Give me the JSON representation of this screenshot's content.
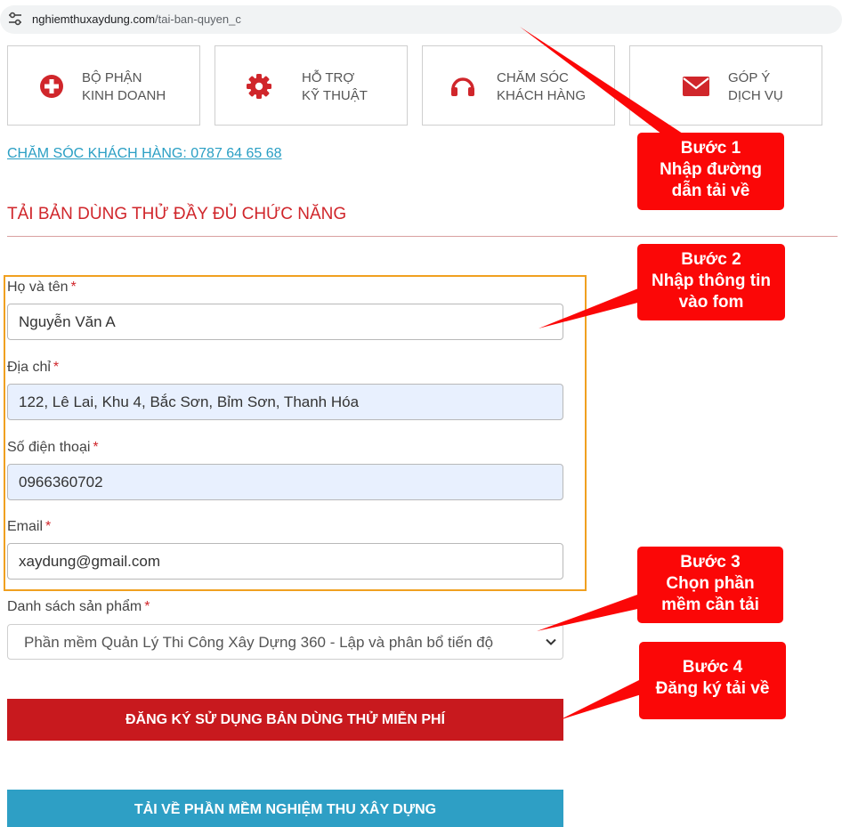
{
  "browser": {
    "url_host": "nghiemthuxaydung.com",
    "url_path": "/tai-ban-quyen_c",
    "site_info_icon": "tune-icon"
  },
  "support": [
    {
      "line1": "BỘ PHẬN",
      "line2": "KINH DOANH",
      "icon": "plus-circle-icon"
    },
    {
      "line1": "HỖ TRỢ",
      "line2": "KỸ THUẬT",
      "icon": "gear-icon"
    },
    {
      "line1": "CHĂM SÓC",
      "line2": "KHÁCH HÀNG",
      "icon": "headphones-icon"
    },
    {
      "line1": "GÓP Ý",
      "line2": "DỊCH VỤ",
      "icon": "envelope-icon"
    }
  ],
  "hotline": "CHĂM SÓC KHÁCH HÀNG: 0787 64 65 68",
  "section_title": "TẢI BẢN DÙNG THỬ ĐẦY ĐỦ CHỨC NĂNG",
  "form": {
    "required_mark": "*",
    "name": {
      "label": "Họ và tên",
      "value": "Nguyễn Văn A"
    },
    "address": {
      "label": "Địa chỉ",
      "value": "122, Lê Lai, Khu 4, Bắc Sơn, Bỉm Sơn, Thanh Hóa"
    },
    "phone": {
      "label": "Số điện thoại",
      "value": "0966360702"
    },
    "email": {
      "label": "Email",
      "value": "xaydung@gmail.com"
    },
    "product": {
      "label": "Danh sách sản phẩm",
      "value": "Phần mềm Quản Lý Thi Công Xây Dựng 360 - Lập và phân bổ tiến độ"
    }
  },
  "buttons": {
    "register": "ĐĂNG KÝ SỬ DỤNG BẢN DÙNG THỬ MIỄN PHÍ",
    "download": "TẢI VỀ PHẦN MỀM NGHIỆM THU XÂY DỰNG"
  },
  "callouts": [
    {
      "line1": "Bước 1",
      "line2": "Nhập đường",
      "line3": "dẫn tải về"
    },
    {
      "line1": "Bước 2",
      "line2": "Nhập thông tin",
      "line3": "vào fom"
    },
    {
      "line1": "Bước 3",
      "line2": "Chọn phần",
      "line3": "mềm cần tải"
    },
    {
      "line1": "Bước 4",
      "line2": "Đăng ký tải về"
    }
  ],
  "colors": {
    "brand_red": "#c8191e",
    "callout_red": "#fb0707",
    "link_blue": "#2a9fc4",
    "button_blue": "#2e9fc5",
    "form_frame": "#f0a020"
  }
}
